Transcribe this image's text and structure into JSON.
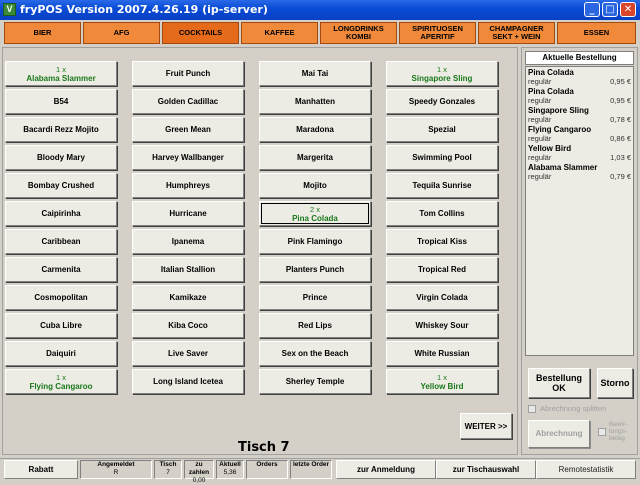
{
  "window": {
    "title": "fryPOS Version 2007.4.26.19 (ip-server)",
    "icon_letter": "V",
    "controls": {
      "minimize": "_",
      "maximize": "□",
      "close": "✕"
    }
  },
  "categories": [
    "BIER",
    "AFG",
    "COCKTAILS",
    "KAFFEE",
    "LONGDRINKS\nKOMBI",
    "SPIRITUOSEN\nAPERITIF",
    "CHAMPAGNER\nSEKT + WEIN",
    "ESSEN"
  ],
  "products": [
    {
      "name": "Alabama Slammer",
      "qty": "1 x"
    },
    {
      "name": "Fruit Punch",
      "qty": ""
    },
    {
      "name": "Mai Tai",
      "qty": ""
    },
    {
      "name": "Singapore Sling",
      "qty": "1 x"
    },
    {
      "name": "B54",
      "qty": ""
    },
    {
      "name": "Golden Cadillac",
      "qty": ""
    },
    {
      "name": "Manhatten",
      "qty": ""
    },
    {
      "name": "Speedy Gonzales",
      "qty": ""
    },
    {
      "name": "Bacardi Rezz Mojito",
      "qty": ""
    },
    {
      "name": "Green Mean",
      "qty": ""
    },
    {
      "name": "Maradona",
      "qty": ""
    },
    {
      "name": "Spezial",
      "qty": ""
    },
    {
      "name": "Bloody Mary",
      "qty": ""
    },
    {
      "name": "Harvey Wallbanger",
      "qty": ""
    },
    {
      "name": "Margerita",
      "qty": ""
    },
    {
      "name": "Swimming Pool",
      "qty": ""
    },
    {
      "name": "Bombay Crushed",
      "qty": ""
    },
    {
      "name": "Humphreys",
      "qty": ""
    },
    {
      "name": "Mojito",
      "qty": ""
    },
    {
      "name": "Tequila Sunrise",
      "qty": ""
    },
    {
      "name": "Caipirinha",
      "qty": ""
    },
    {
      "name": "Hurricane",
      "qty": ""
    },
    {
      "name": "Pina Colada",
      "qty": "2 x"
    },
    {
      "name": "Tom Collins",
      "qty": ""
    },
    {
      "name": "Caribbean",
      "qty": ""
    },
    {
      "name": "Ipanema",
      "qty": ""
    },
    {
      "name": "Pink Flamingo",
      "qty": ""
    },
    {
      "name": "Tropical Kiss",
      "qty": ""
    },
    {
      "name": "Carmenita",
      "qty": ""
    },
    {
      "name": "Italian Stallion",
      "qty": ""
    },
    {
      "name": "Planters Punch",
      "qty": ""
    },
    {
      "name": "Tropical Red",
      "qty": ""
    },
    {
      "name": "Cosmopolitan",
      "qty": ""
    },
    {
      "name": "Kamikaze",
      "qty": ""
    },
    {
      "name": "Prince",
      "qty": ""
    },
    {
      "name": "Virgin Colada",
      "qty": ""
    },
    {
      "name": "Cuba Libre",
      "qty": ""
    },
    {
      "name": "Kiba Coco",
      "qty": ""
    },
    {
      "name": "Red Lips",
      "qty": ""
    },
    {
      "name": "Whiskey Sour",
      "qty": ""
    },
    {
      "name": "Daiquiri",
      "qty": ""
    },
    {
      "name": "Live Saver",
      "qty": ""
    },
    {
      "name": "Sex on the Beach",
      "qty": ""
    },
    {
      "name": "White Russian",
      "qty": ""
    },
    {
      "name": "Flying Cangaroo",
      "qty": "1 x"
    },
    {
      "name": "Long Island Icetea",
      "qty": ""
    },
    {
      "name": "Sherley Temple",
      "qty": ""
    },
    {
      "name": "Yellow Bird",
      "qty": "1 x"
    }
  ],
  "main": {
    "table_label": "Tisch 7",
    "next_button": "WEITER >>"
  },
  "order": {
    "title": "Aktuelle Bestellung",
    "items": [
      {
        "name": "Pina Colada",
        "size": "regulär",
        "price": "0,95 €"
      },
      {
        "name": "Pina Colada",
        "size": "regulär",
        "price": "0,95 €"
      },
      {
        "name": "Singapore Sling",
        "size": "regulär",
        "price": "0,78 €"
      },
      {
        "name": "Flying Cangaroo",
        "size": "regulär",
        "price": "0,86 €"
      },
      {
        "name": "Yellow Bird",
        "size": "regulär",
        "price": "1,03 €"
      },
      {
        "name": "Alabama Slammer",
        "size": "regulär",
        "price": "0,79 €"
      }
    ],
    "ok_button": "Bestellung\nOK",
    "cancel_button": "Storno",
    "split_label": "Abrechnung splitten",
    "billing_button": "Abrechnung",
    "receipt_label": "Bewir-\ntungs-\nbeleg"
  },
  "status": {
    "discount_button": "Rabatt",
    "cells": [
      {
        "label": "Angemeldet",
        "value": "R"
      },
      {
        "label": "Tisch",
        "value": "7"
      },
      {
        "label": "zu zahlen",
        "value": "0,00"
      },
      {
        "label": "Aktuell",
        "value": "5,36"
      },
      {
        "label": "Orders",
        "value": ""
      },
      {
        "label": "letzte Order",
        "value": ""
      }
    ],
    "login_button": "zur Anmeldung",
    "tables_button": "zur Tischauswahl",
    "remote_button": "Remotestatistik"
  }
}
